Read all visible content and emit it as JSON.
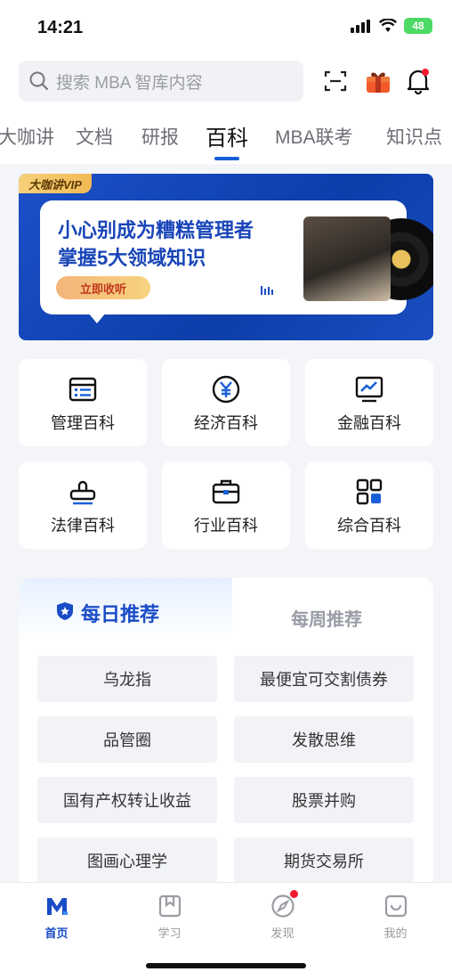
{
  "status_bar": {
    "time": "14:21",
    "battery": "48"
  },
  "search": {
    "placeholder": "搜索 MBA 智库内容"
  },
  "tabs": [
    {
      "label": "大咖讲"
    },
    {
      "label": "文档"
    },
    {
      "label": "研报"
    },
    {
      "label": "百科"
    },
    {
      "label": "MBA联考"
    },
    {
      "label": "知识点"
    }
  ],
  "banner": {
    "tag": "大咖讲VIP",
    "title_line1": "小心别成为糟糕管理者",
    "title_line2": "掌握5大领域知识",
    "button": "立即收听"
  },
  "categories": [
    {
      "label": "管理百科",
      "icon": "list-document-icon"
    },
    {
      "label": "经济百科",
      "icon": "yuan-coin-icon"
    },
    {
      "label": "金融百科",
      "icon": "chart-monitor-icon"
    },
    {
      "label": "法律百科",
      "icon": "stamp-icon"
    },
    {
      "label": "行业百科",
      "icon": "briefcase-icon"
    },
    {
      "label": "综合百科",
      "icon": "grid-apps-icon"
    }
  ],
  "recommend": {
    "daily_tab": "每日推荐",
    "weekly_tab": "每周推荐",
    "items": [
      "乌龙指",
      "最便宜可交割债券",
      "品管圈",
      "发散思维",
      "国有产权转让收益",
      "股票并购",
      "图画心理学",
      "期货交易所"
    ]
  },
  "bottom_nav": [
    {
      "label": "首页",
      "icon": "home-m-icon"
    },
    {
      "label": "学习",
      "icon": "book-icon"
    },
    {
      "label": "发现",
      "icon": "compass-icon"
    },
    {
      "label": "我的",
      "icon": "profile-icon"
    }
  ],
  "colors": {
    "accent": "#1a4cc7",
    "banner_bg": "#1b50c8",
    "badge_red": "#f21b2d"
  }
}
